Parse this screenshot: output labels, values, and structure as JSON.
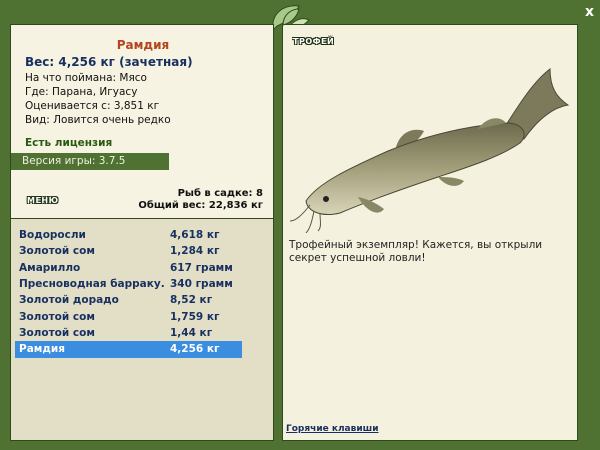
{
  "fish": {
    "name": "Рамдия",
    "weight_line": "Вес: 4,256 кг (зачетная)",
    "bait": "На что поймана: Мясо",
    "location": "Где: Парана, Игуасу",
    "value": "Оценивается с: 3,851 кг",
    "rarity": "Вид: Ловится очень редко"
  },
  "license": "Есть лицензия",
  "version": "Версия игры: 3.7.5",
  "menu_label": "МЕНЮ",
  "stats": {
    "count": "Рыб в садке: 8",
    "total": "Общий вес: 22,836 кг"
  },
  "catch_list": [
    {
      "name": "Водоросли",
      "weight": "4,618 кг"
    },
    {
      "name": "Золотой сом",
      "weight": "1,284 кг"
    },
    {
      "name": "Амарилло",
      "weight": "617 грамм"
    },
    {
      "name": "Пресноводная барраку...",
      "weight": "340 грамм"
    },
    {
      "name": "Золотой дорадо",
      "weight": "8,52 кг"
    },
    {
      "name": "Золотой сом",
      "weight": "1,759 кг"
    },
    {
      "name": "Золотой сом",
      "weight": "1,44 кг"
    },
    {
      "name": "Рамдия",
      "weight": "4,256 кг"
    }
  ],
  "selected_index": 7,
  "trophy": {
    "label": "ТРОФЕЙ",
    "text": "Трофейный экземпляр! Кажется, вы открыли секрет успешной ловли!",
    "hotkeys": "Горячие клавиши"
  },
  "close_label": "x",
  "colors": {
    "frame": "#4f7233",
    "panel": "#f4f1df",
    "list_bg": "#e3dfc7",
    "selected": "#3b8de0",
    "title": "#b3451f",
    "navy": "#17305f"
  }
}
